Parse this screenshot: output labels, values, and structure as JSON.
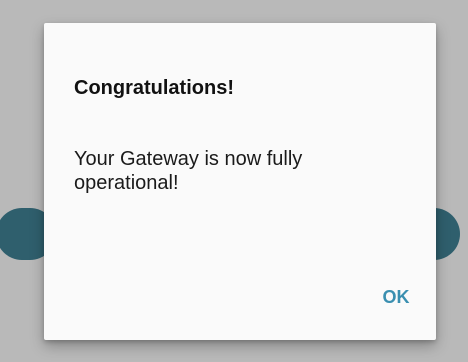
{
  "dialog": {
    "title": "Congratulations!",
    "message": "Your Gateway is now fully operational!",
    "ok_label": "OK"
  },
  "colors": {
    "accent": "#3a8fb0",
    "scrim": "#b9b9b9",
    "background_pill": "#2f5f6d",
    "dialog_surface": "#fafafa"
  }
}
